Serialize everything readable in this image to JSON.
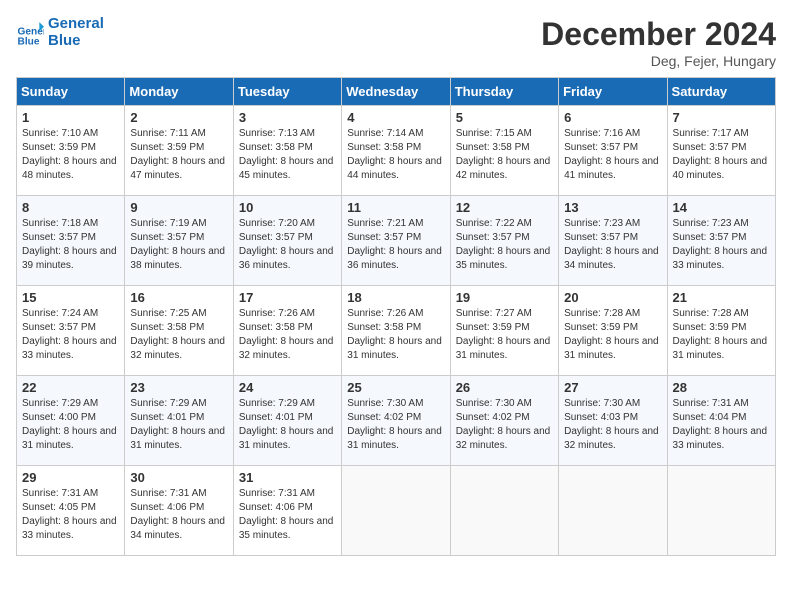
{
  "header": {
    "logo_line1": "General",
    "logo_line2": "Blue",
    "month_title": "December 2024",
    "location": "Deg, Fejer, Hungary"
  },
  "weekdays": [
    "Sunday",
    "Monday",
    "Tuesday",
    "Wednesday",
    "Thursday",
    "Friday",
    "Saturday"
  ],
  "weeks": [
    [
      {
        "day": "1",
        "sunrise": "Sunrise: 7:10 AM",
        "sunset": "Sunset: 3:59 PM",
        "daylight": "Daylight: 8 hours and 48 minutes."
      },
      {
        "day": "2",
        "sunrise": "Sunrise: 7:11 AM",
        "sunset": "Sunset: 3:59 PM",
        "daylight": "Daylight: 8 hours and 47 minutes."
      },
      {
        "day": "3",
        "sunrise": "Sunrise: 7:13 AM",
        "sunset": "Sunset: 3:58 PM",
        "daylight": "Daylight: 8 hours and 45 minutes."
      },
      {
        "day": "4",
        "sunrise": "Sunrise: 7:14 AM",
        "sunset": "Sunset: 3:58 PM",
        "daylight": "Daylight: 8 hours and 44 minutes."
      },
      {
        "day": "5",
        "sunrise": "Sunrise: 7:15 AM",
        "sunset": "Sunset: 3:58 PM",
        "daylight": "Daylight: 8 hours and 42 minutes."
      },
      {
        "day": "6",
        "sunrise": "Sunrise: 7:16 AM",
        "sunset": "Sunset: 3:57 PM",
        "daylight": "Daylight: 8 hours and 41 minutes."
      },
      {
        "day": "7",
        "sunrise": "Sunrise: 7:17 AM",
        "sunset": "Sunset: 3:57 PM",
        "daylight": "Daylight: 8 hours and 40 minutes."
      }
    ],
    [
      {
        "day": "8",
        "sunrise": "Sunrise: 7:18 AM",
        "sunset": "Sunset: 3:57 PM",
        "daylight": "Daylight: 8 hours and 39 minutes."
      },
      {
        "day": "9",
        "sunrise": "Sunrise: 7:19 AM",
        "sunset": "Sunset: 3:57 PM",
        "daylight": "Daylight: 8 hours and 38 minutes."
      },
      {
        "day": "10",
        "sunrise": "Sunrise: 7:20 AM",
        "sunset": "Sunset: 3:57 PM",
        "daylight": "Daylight: 8 hours and 36 minutes."
      },
      {
        "day": "11",
        "sunrise": "Sunrise: 7:21 AM",
        "sunset": "Sunset: 3:57 PM",
        "daylight": "Daylight: 8 hours and 36 minutes."
      },
      {
        "day": "12",
        "sunrise": "Sunrise: 7:22 AM",
        "sunset": "Sunset: 3:57 PM",
        "daylight": "Daylight: 8 hours and 35 minutes."
      },
      {
        "day": "13",
        "sunrise": "Sunrise: 7:23 AM",
        "sunset": "Sunset: 3:57 PM",
        "daylight": "Daylight: 8 hours and 34 minutes."
      },
      {
        "day": "14",
        "sunrise": "Sunrise: 7:23 AM",
        "sunset": "Sunset: 3:57 PM",
        "daylight": "Daylight: 8 hours and 33 minutes."
      }
    ],
    [
      {
        "day": "15",
        "sunrise": "Sunrise: 7:24 AM",
        "sunset": "Sunset: 3:57 PM",
        "daylight": "Daylight: 8 hours and 33 minutes."
      },
      {
        "day": "16",
        "sunrise": "Sunrise: 7:25 AM",
        "sunset": "Sunset: 3:58 PM",
        "daylight": "Daylight: 8 hours and 32 minutes."
      },
      {
        "day": "17",
        "sunrise": "Sunrise: 7:26 AM",
        "sunset": "Sunset: 3:58 PM",
        "daylight": "Daylight: 8 hours and 32 minutes."
      },
      {
        "day": "18",
        "sunrise": "Sunrise: 7:26 AM",
        "sunset": "Sunset: 3:58 PM",
        "daylight": "Daylight: 8 hours and 31 minutes."
      },
      {
        "day": "19",
        "sunrise": "Sunrise: 7:27 AM",
        "sunset": "Sunset: 3:59 PM",
        "daylight": "Daylight: 8 hours and 31 minutes."
      },
      {
        "day": "20",
        "sunrise": "Sunrise: 7:28 AM",
        "sunset": "Sunset: 3:59 PM",
        "daylight": "Daylight: 8 hours and 31 minutes."
      },
      {
        "day": "21",
        "sunrise": "Sunrise: 7:28 AM",
        "sunset": "Sunset: 3:59 PM",
        "daylight": "Daylight: 8 hours and 31 minutes."
      }
    ],
    [
      {
        "day": "22",
        "sunrise": "Sunrise: 7:29 AM",
        "sunset": "Sunset: 4:00 PM",
        "daylight": "Daylight: 8 hours and 31 minutes."
      },
      {
        "day": "23",
        "sunrise": "Sunrise: 7:29 AM",
        "sunset": "Sunset: 4:01 PM",
        "daylight": "Daylight: 8 hours and 31 minutes."
      },
      {
        "day": "24",
        "sunrise": "Sunrise: 7:29 AM",
        "sunset": "Sunset: 4:01 PM",
        "daylight": "Daylight: 8 hours and 31 minutes."
      },
      {
        "day": "25",
        "sunrise": "Sunrise: 7:30 AM",
        "sunset": "Sunset: 4:02 PM",
        "daylight": "Daylight: 8 hours and 31 minutes."
      },
      {
        "day": "26",
        "sunrise": "Sunrise: 7:30 AM",
        "sunset": "Sunset: 4:02 PM",
        "daylight": "Daylight: 8 hours and 32 minutes."
      },
      {
        "day": "27",
        "sunrise": "Sunrise: 7:30 AM",
        "sunset": "Sunset: 4:03 PM",
        "daylight": "Daylight: 8 hours and 32 minutes."
      },
      {
        "day": "28",
        "sunrise": "Sunrise: 7:31 AM",
        "sunset": "Sunset: 4:04 PM",
        "daylight": "Daylight: 8 hours and 33 minutes."
      }
    ],
    [
      {
        "day": "29",
        "sunrise": "Sunrise: 7:31 AM",
        "sunset": "Sunset: 4:05 PM",
        "daylight": "Daylight: 8 hours and 33 minutes."
      },
      {
        "day": "30",
        "sunrise": "Sunrise: 7:31 AM",
        "sunset": "Sunset: 4:06 PM",
        "daylight": "Daylight: 8 hours and 34 minutes."
      },
      {
        "day": "31",
        "sunrise": "Sunrise: 7:31 AM",
        "sunset": "Sunset: 4:06 PM",
        "daylight": "Daylight: 8 hours and 35 minutes."
      },
      null,
      null,
      null,
      null
    ]
  ]
}
